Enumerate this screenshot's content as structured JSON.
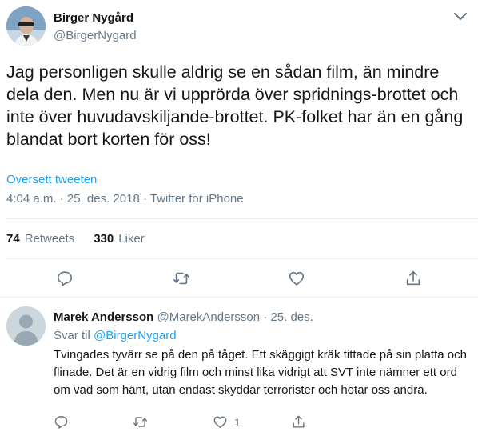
{
  "tweet": {
    "author_name": "Birger Nygård",
    "author_handle": "@BirgerNygard",
    "text": "Jag personligen skulle aldrig se en sådan film, än mindre dela den. Men nu är vi upprörda över spridnings-brottet och inte över huvudavskiljande-brottet. PK-folket har än en gång blandat bort korten för oss!",
    "translate_label": "Oversett tweeten",
    "time": "4:04 a.m.",
    "separator": " · ",
    "date": "25. des. 2018",
    "source": "Twitter for iPhone",
    "retweets_count": "74",
    "retweets_label": "Retweets",
    "likes_count": "330",
    "likes_label": "Liker"
  },
  "reply": {
    "author_name": "Marek Andersson",
    "author_handle": "@MarekAndersson",
    "date": "25. des.",
    "reply_to_label": "Svar til",
    "reply_to_handle": "@BirgerNygard",
    "text": "Tvingades tyvärr se på den på tåget. Ett skäggigt kräk tittade på sin platta och flinade. Det är en vidrig film och minst lika vidrigt att SVT inte nämner ett ord om vad som hänt, utan endast skyddar terrorister och hotar oss andra.",
    "like_count": "1"
  },
  "icons": [
    "chevron-down-icon",
    "reply-icon",
    "retweet-icon",
    "like-icon",
    "share-icon"
  ],
  "colors": {
    "link": "#1da1f2",
    "secondary_text": "#657786",
    "divider": "#e6ecf0"
  }
}
